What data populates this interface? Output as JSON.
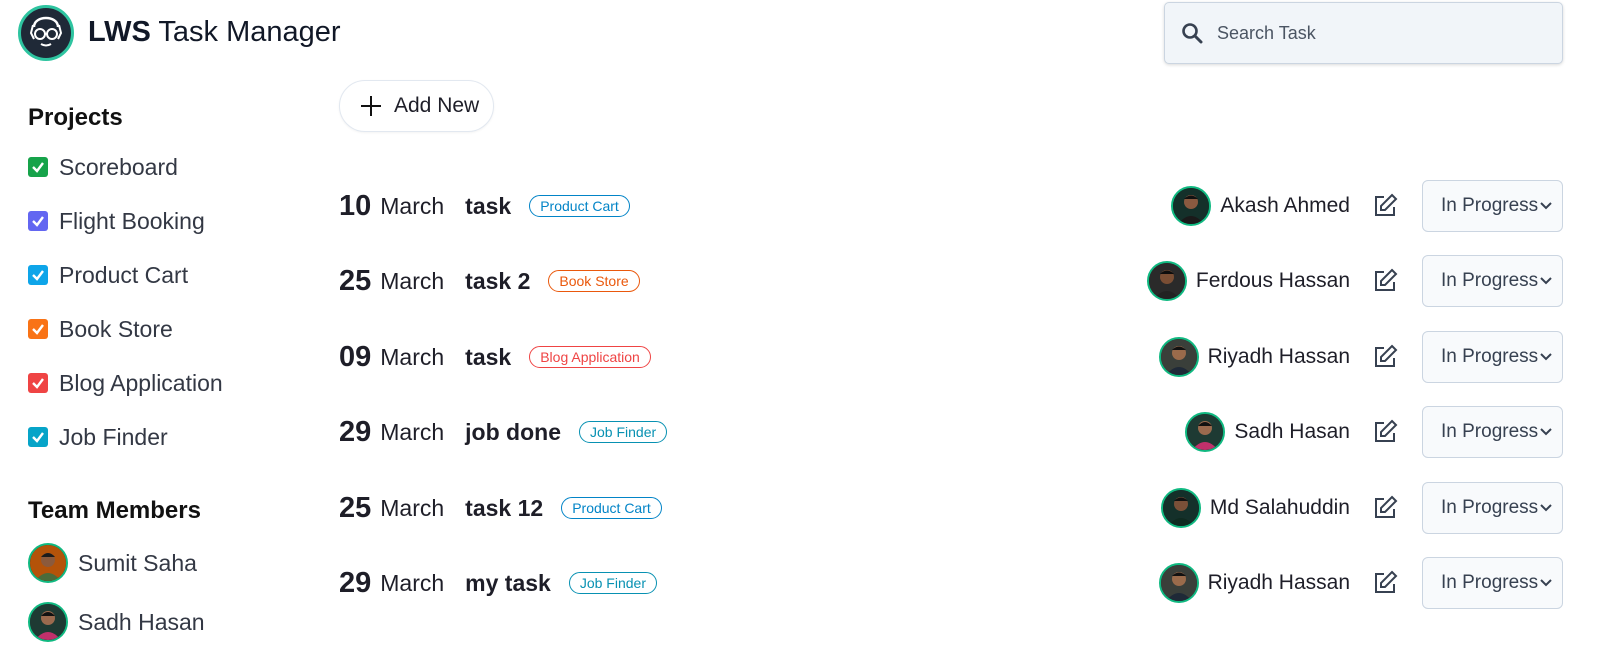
{
  "header": {
    "logo_icon": "glasses-face-logo",
    "title_bold": "LWS",
    "title_rest": "Task Manager"
  },
  "search": {
    "icon": "search-icon",
    "placeholder": "Search Task"
  },
  "sidebar": {
    "projects_title": "Projects",
    "projects": [
      {
        "label": "Scoreboard",
        "color": "#16a34a",
        "checked": true
      },
      {
        "label": "Flight Booking",
        "color": "#6366f1",
        "checked": true
      },
      {
        "label": "Product Cart",
        "color": "#0ea5e9",
        "checked": true
      },
      {
        "label": "Book Store",
        "color": "#f97316",
        "checked": true
      },
      {
        "label": "Blog Application",
        "color": "#ef4444",
        "checked": true
      },
      {
        "label": "Job Finder",
        "color": "#06a4c8",
        "checked": true
      }
    ],
    "team_title": "Team Members",
    "members": [
      {
        "name": "Sumit Saha"
      },
      {
        "name": "Sadh Hasan"
      }
    ]
  },
  "toolbar": {
    "add_label": "Add New",
    "add_icon": "plus-icon"
  },
  "tasks": [
    {
      "day": "10",
      "month": "March",
      "name": "task",
      "project": "Product Cart",
      "project_color": "#0284c7",
      "assignee": "Akash Ahmed",
      "status": "In Progress"
    },
    {
      "day": "25",
      "month": "March",
      "name": "task 2",
      "project": "Book Store",
      "project_color": "#ea580c",
      "assignee": "Ferdous Hassan",
      "status": "In Progress"
    },
    {
      "day": "09",
      "month": "March",
      "name": "task",
      "project": "Blog Application",
      "project_color": "#ef4444",
      "assignee": "Riyadh Hassan",
      "status": "In Progress"
    },
    {
      "day": "29",
      "month": "March",
      "name": "job done",
      "project": "Job Finder",
      "project_color": "#0891b2",
      "assignee": "Sadh Hasan",
      "status": "In Progress"
    },
    {
      "day": "25",
      "month": "March",
      "name": "task 12",
      "project": "Product Cart",
      "project_color": "#0284c7",
      "assignee": "Md Salahuddin",
      "status": "In Progress"
    },
    {
      "day": "29",
      "month": "March",
      "name": "my task",
      "project": "Job Finder",
      "project_color": "#0891b2",
      "assignee": "Riyadh Hassan",
      "status": "In Progress"
    }
  ],
  "colors": {
    "accent": "#10b981",
    "text": "#1e1e28"
  }
}
